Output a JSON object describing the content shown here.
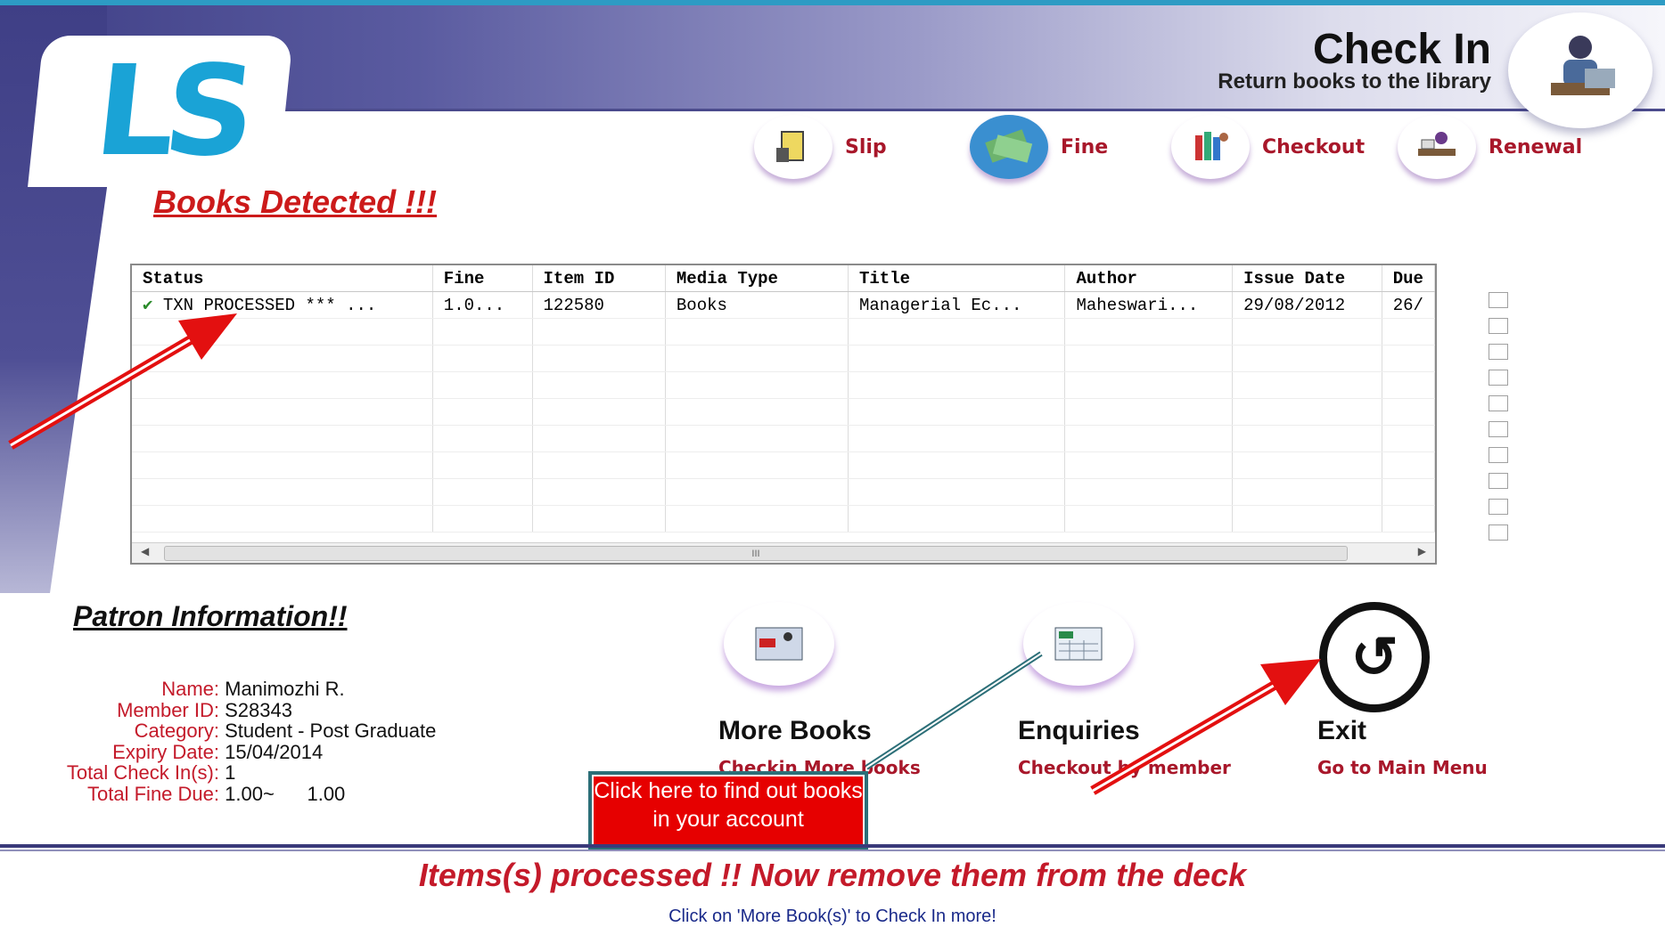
{
  "header": {
    "title": "Check In",
    "subtitle": "Return books to the library",
    "logo_text": "LS",
    "portrait_icon": "librarian-icon"
  },
  "nav": [
    {
      "label": "Slip",
      "icon": "slip-icon"
    },
    {
      "label": "Fine",
      "icon": "money-icon"
    },
    {
      "label": "Checkout",
      "icon": "checkout-icon"
    },
    {
      "label": "Renewal",
      "icon": "renewal-icon"
    }
  ],
  "books_detected": "Books Detected !!!",
  "table": {
    "columns": [
      "Status",
      "Fine",
      "Item ID",
      "Media Type",
      "Title",
      "Author",
      "Issue Date",
      "Due"
    ],
    "rows": [
      [
        "TXN PROCESSED *** ...",
        "1.0...",
        "122580",
        "Books",
        "Managerial Ec...",
        "Maheswari...",
        "29/08/2012",
        "26/"
      ]
    ],
    "scroll_marker": "III"
  },
  "patron": {
    "title": "Patron Information!!",
    "fields": [
      {
        "label": "Name:",
        "value": "Manimozhi R."
      },
      {
        "label": "Member ID:",
        "value": "S28343"
      },
      {
        "label": "Category:",
        "value": "Student - Post Graduate"
      },
      {
        "label": "Expiry Date:",
        "value": "15/04/2014"
      },
      {
        "label": "Total Check In(s):",
        "value": "1"
      },
      {
        "label": "Total Fine Due:",
        "value": "1.00~      1.00"
      }
    ]
  },
  "actions": {
    "more_books": {
      "title": "More Books",
      "subtitle": "Checkin More books"
    },
    "enquiries": {
      "title": "Enquiries",
      "subtitle": "Checkout by member"
    },
    "exit": {
      "title": "Exit",
      "subtitle": "Go to Main Menu"
    }
  },
  "callout": "Click here to find out books in your account",
  "footer": {
    "message": "Items(s) processed !! Now remove them from the deck",
    "hint": "Click on 'More Book(s)' to Check In more!"
  },
  "colors": {
    "accent_red": "#c41a2a",
    "logo_blue": "#1aa3d6",
    "header_purple": "#3f3f86",
    "callout_red": "#e60000"
  }
}
